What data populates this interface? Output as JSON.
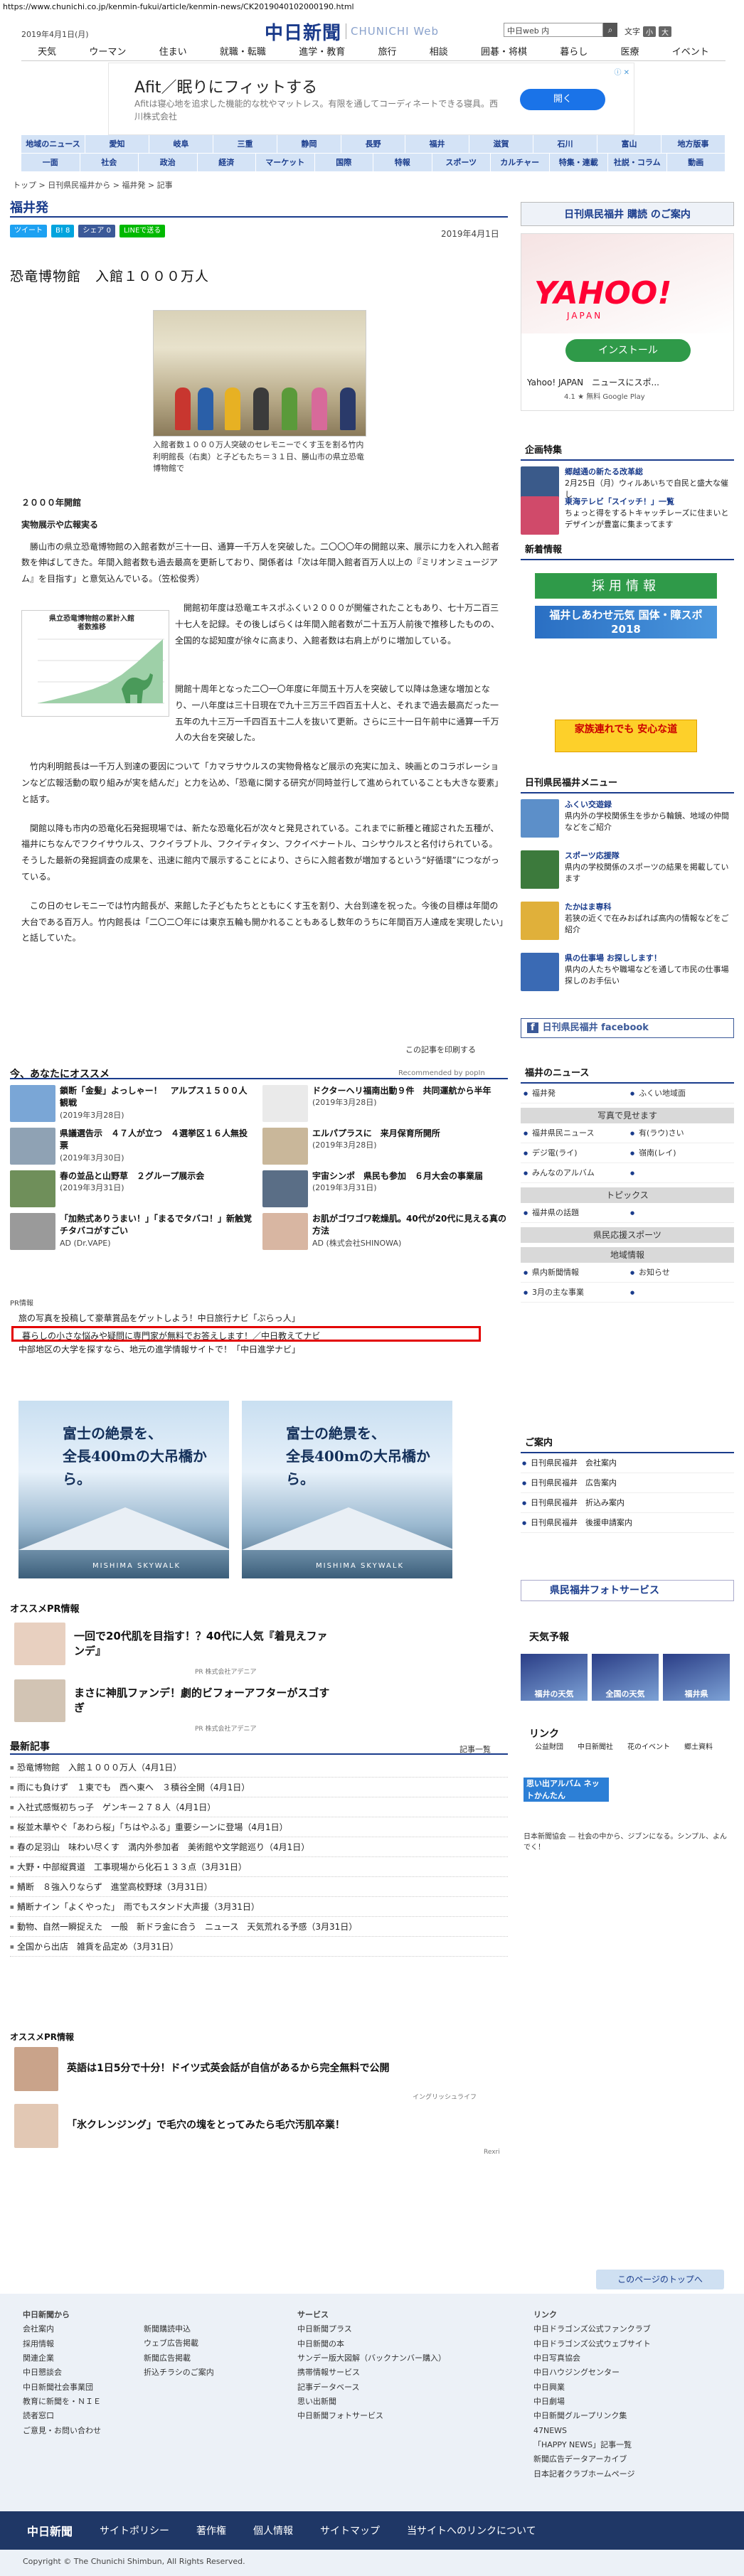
{
  "browser": {
    "url": "https://www.chunichi.co.jp/kenmin-fukui/article/kenmin-news/CK2019040102000190.html"
  },
  "header": {
    "date": "2019年4月1日(月)",
    "logo_ja": "中日新聞",
    "logo_en": "CHUNICHI Web",
    "search_placeholder": "中日web 内",
    "font_size_label": "文字",
    "font_small": "小",
    "font_large": "大",
    "nav": [
      "天気",
      "ウーマン",
      "住まい",
      "就職・転職",
      "進学・教育",
      "旅行",
      "相談",
      "囲碁・将棋",
      "暮らし",
      "医療",
      "イベント"
    ]
  },
  "top_ad": {
    "headline": "Afit／眠りにフィットする",
    "desc": "Afitは寝心地を追求した機能的な枕やマットレス。有限を通してコーディネートできる寝具。西川株式会社",
    "button": "開く"
  },
  "section_nav": {
    "row1": [
      "地域のニュース",
      "愛知",
      "岐阜",
      "三重",
      "静岡",
      "長野",
      "福井",
      "滋賀",
      "石川",
      "富山",
      "地方版事"
    ],
    "row2": [
      "一面",
      "社会",
      "政治",
      "経済",
      "マーケット",
      "国際",
      "特報",
      "スポーツ",
      "カルチャー",
      "特集・連載",
      "社説・コラム",
      "動画"
    ]
  },
  "breadcrumb": "トップ > 日刊県民福井から > 福井発 > 記事",
  "page_title": "福井発",
  "share": {
    "tweet": "ツイート",
    "hatena": "B! 8",
    "fb": "シェア 0",
    "line": "LINEで送る"
  },
  "article": {
    "date": "2019年4月1日",
    "headline": "恐竜博物館　入館１０００万人",
    "photo_caption": "入館者数１０００万人突破のセレモニーでくす玉を割る竹内利明館長（右奥）と子どもたち＝３１日、勝山市の県立恐竜博物館で",
    "section1": "２０００年開館",
    "section2": "実物展示や広報実る",
    "p1": "勝山市の県立恐竜博物館の入館者数が三十一日、通算一千万人を突破した。二〇〇〇年の開館以来、展示に力を入れ入館者数を伸ばしてきた。年間入館者数も過去最高を更新しており、関係者は「次は年間入館者百万人以上の『ミリオンミュージアム』を目指す」と意気込んでいる。（笠松俊秀）",
    "chart_title": "県立恐竜博物館の累計入館者数推移",
    "p2": "開館初年度は恐竜エキスポふくい２０００が開催されたこともあり、七十万二百三十七人を記録。その後しばらくは年間入館者数が二十五万人前後で推移したものの、全国的な認知度が徐々に高まり、入館者数は右肩上がりに増加している。",
    "p3": "開館十周年となった二〇一〇年度に年間五十万人を突破して以降は急速な増加となり、一八年度は三十日現在で九十三万三千四百五十人と、それまで過去最高だった一五年の九十三万一千四百五十二人を抜いて更新。さらに三十一日午前中に通算一千万人の大台を突破した。",
    "p4": "竹内利明館長は一千万人到達の要因について「カマラサウルスの実物骨格など展示の充実に加え、映画とのコラボレーションなど広報活動の取り組みが実を結んだ」と力を込め、「恐竜に関する研究が同時並行して進められていることも大きな要素」と話す。",
    "p5": "関館以降も市内の恐竜化石発掘現場では、新たな恐竜化石が次々と発見されている。これまでに新種と確認された五種が、福井にちなんでフクイサウルス、フクイラプトル、フクイティタン、フクイベナートル、コシサウルスと名付けられている。そうした最新の発掘調査の成果を、迅速に館内で展示することにより、さらに入館者数が増加するという“好循環”につながっている。",
    "p6": "この日のセレモニーでは竹内館長が、来館した子どもたちとともにくす玉を割り、大台到達を祝った。今後の目標は年間の大台である百万人。竹内館長は「二〇二〇年には東京五輪も開かれることもあるし数年のうちに年間百万人達成を実現したい」と話していた。",
    "print": "この記事を印刷する"
  },
  "recommend": {
    "heading": "今、あなたにオススメ",
    "by": "Recommended by popIn",
    "items": [
      {
        "title": "鎖断「金髪」よっしゃー！　アルプス１５００人観戦",
        "date": "(2019年3月28日)"
      },
      {
        "title": "ドクターヘリ福南出動９件　共同運航から半年",
        "date": "(2019年3月28日)"
      },
      {
        "title": "県議選告示　４７人が立つ　４選挙区１６人無投票",
        "date": "(2019年3月30日)"
      },
      {
        "title": "エルパプラスに　来月保育所開所",
        "date": "(2019年3月28日)"
      },
      {
        "title": "春の並品と山野草　２グループ展示会",
        "date": "(2019年3月31日)"
      },
      {
        "title": "宇宙シンポ　県民も参加　６月大会の事業届",
        "date": "(2019年3月31日)"
      },
      {
        "title": "「加熱式ありうまい！」「まるでタバコ！」新触覚チタバコがすごい",
        "date": "AD (Dr.VAPE)"
      },
      {
        "title": "お肌がゴワゴワ乾燥肌。40代が20代に見える真の方法",
        "date": "AD (株式会社SHINOWA)"
      }
    ]
  },
  "pr": {
    "label": "PR情報",
    "items": [
      "旅の写真を投稿して豪華賞品をゲットしよう！中日旅行ナビ「ぶらっ人」",
      "暮らしの小さな悩みや疑問に専門家が無料でお答えします！／中日教えてナビ",
      "中部地区の大学を探すなら、地元の進学情報サイトで！「中日進学ナビ」"
    ]
  },
  "banner": {
    "copy1": "富士の絶景を、",
    "copy2": "全長400mの大吊橋から。",
    "logo": "MISHIMA SKYWALK"
  },
  "opr": {
    "heading": "オススメPR情報",
    "items": [
      {
        "title": "一回で20代肌を目指す！？40代に人気『着見えファンデ』",
        "label": "PR 株式会社アデニア"
      },
      {
        "title": "まさに神肌ファンデ！劇的ビフォーアフターがスゴすぎ",
        "label": "PR 株式会社アデニア"
      }
    ]
  },
  "latest": {
    "heading": "最新記事",
    "more": "記事一覧",
    "items": [
      "恐竜博物館　入館１０００万人（4月1日）",
      "雨にも負けず　１東でも　西へ東へ　３積谷全開（4月1日）",
      "入社式感慨初ちっ子　ゲンキー２７８人（4月1日）",
      "桜並木華やぐ「あわら桜」「ちはやふる」重要シーンに登場（4月1日）",
      "春の足羽山　味わい尽くす　満内外参加者　美術館や文学館巡り（4月1日）",
      "大野・中部縦貫道　工事現場から化石１３３点（3月31日）",
      "鯖断　８強入りならず　進堂高校野球（3月31日）",
      "鯖断ナイン「よくやった」　雨でもスタンド大声援（3月31日）",
      "動物、自然一瞬捉えた　一般　新ドラ金に合う　ニュース　天気荒れる予感（3月31日）",
      "全国から出店　雑貨を品定め（3月31日）"
    ]
  },
  "opr2": {
    "heading": "オススメPR情報",
    "items": [
      {
        "title": "英語は1日5分で十分！ドイツ式英会話が自信があるから完全無料で公開",
        "label": "イングリッシュライフ"
      },
      {
        "title": "「氷クレンジング」で毛穴の塊をとってみたら毛穴汚肌卒業！",
        "label": "Rexri"
      }
    ]
  },
  "sidebar": {
    "buy": "日刊県民福井 購読 のご案内",
    "yahoo_ad": {
      "brand": "YAHOO!",
      "sub": "JAPAN",
      "install": "インストール",
      "app": "Yahoo! JAPAN　ニュースにスポ...",
      "rating": "4.1 ★ 無料  Google Play"
    },
    "kikaku_h": "企画特集",
    "kikaku": [
      {
        "title": "郷越通の新たる改革総",
        "text": "2月25日（月）ウィルあいちで自民と盛大な催し"
      },
      {
        "title": "東海テレビ「スイッチ！」一覧",
        "text": "ちょっと得をするトキャッチレーズに住まいとデザインが豊富に集まってます"
      }
    ],
    "shincho_h": "新着情報",
    "saiyo": "採用情報",
    "kokutai": "福井しあわせ元気 国体・障スポ 2018",
    "kazoku": "家族連れでも 安心な道",
    "menu_h": "日刊県民福井メニュー",
    "menu": [
      {
        "title": "ふくい交遊録",
        "text": "県内外の学校関係生を歩から輪鏡、地域の仲間などをご紹介"
      },
      {
        "title": "スポーツ応援隊",
        "text": "県内の学校関係のスポーツの結果を掲載しています"
      },
      {
        "title": "たかはま専科",
        "text": "若狭の近くで在みおばれば高内の情報などをご紹介"
      },
      {
        "title": "県の仕事場 お探しします！",
        "text": "県内の人たちや職場などを通して市民の仕事場探しのお手伝い"
      }
    ],
    "fb": "日刊県民福井 facebook",
    "fukui_news_h": "福井のニュース",
    "fukui_news": [
      "福井発",
      "ふくい地域面",
      "写真で見せます",
      "福井県民ニュース",
      "有(ラウ)さい",
      "デジ電(ライ)",
      "嶺南(レイ)",
      "みんなのアルバム",
      "トピックス",
      "福井県の話題",
      "県民応援スポーツ",
      "地域情報",
      "県内新聞情報",
      "お知らせ",
      "3月の主な事業"
    ],
    "annai_h": "ご案内",
    "annai": [
      "日刊県民福井　会社案内",
      "日刊県民福井　広告案内",
      "日刊県民福井　折込み案内",
      "日刊県民福井　後援申請案内"
    ],
    "photo": "県民福井フォトサービス",
    "weather_h": "天気予報",
    "weather": [
      "福井の天気",
      "全国の天気",
      "福井県"
    ],
    "link_h": "リンク",
    "links": [
      "公益財団",
      "中日新聞社",
      "花のイベント",
      "郷土資料"
    ],
    "omoide": "思い出アルバム ネットかんたん",
    "nikkei": "日本新聞協会 — 社会の中から、ジブンになる。シンプル、よんでく！"
  },
  "page_top": "このページのトップへ",
  "footer": {
    "cols": [
      {
        "h": "中日新聞から",
        "items": [
          "会社案内",
          "採用情報",
          "関連企業",
          "中日懇談会",
          "中日新聞社会事業団",
          "教育に新聞を・ＮＩＥ",
          "読者窓口",
          "ご意見・お問い合わせ"
        ]
      },
      {
        "h": "",
        "items": [
          "新聞購読申込",
          "ウェブ広告掲載",
          "新聞広告掲載",
          "折込チラシのご案内"
        ]
      },
      {
        "h": "サービス",
        "items": [
          "中日新聞プラス",
          "中日新聞の本",
          "サンデー版大図解（バックナンバー購入）",
          "携帯情報サービス",
          "記事データベース",
          "思い出新聞",
          "中日新聞フォトサービス"
        ]
      },
      {
        "h": "リンク",
        "items": [
          "中日ドラゴンズ公式ファンクラブ",
          "中日ドラゴンズ公式ウェブサイト",
          "中日写真協会",
          "中日ハウジングセンター",
          "中日興業",
          "中日劇場",
          "中日新聞グループリンク集",
          "47NEWS",
          "「HAPPY NEWS」記事一覧",
          "新聞広告データアーカイブ",
          "日本記者クラブホームページ"
        ]
      }
    ],
    "bar": [
      "中日新聞",
      "サイトポリシー",
      "著作権",
      "個人情報",
      "サイトマップ",
      "当サイトへのリンクについて"
    ],
    "copyright": "Copyright © The Chunichi Shimbun, All Rights Reserved."
  }
}
